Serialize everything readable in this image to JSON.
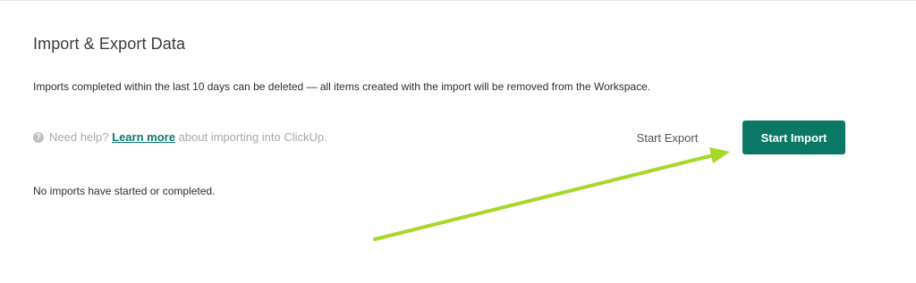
{
  "section": {
    "title": "Import & Export Data",
    "description": "Imports completed within the last 10 days can be deleted — all items created with the import will be removed from the Workspace."
  },
  "help": {
    "icon": "question-circle-icon",
    "prefix": "Need help?",
    "link_label": "Learn more",
    "suffix": "about importing into ClickUp."
  },
  "actions": {
    "start_export_label": "Start Export",
    "start_import_label": "Start Import"
  },
  "imports": {
    "empty_message": "No imports have started or completed."
  },
  "colors": {
    "primary": "#0b7866",
    "link": "#0f7a6c",
    "annotation_arrow": "#a6d827"
  },
  "annotation": {
    "type": "arrow",
    "points_to": "start-import-button"
  }
}
